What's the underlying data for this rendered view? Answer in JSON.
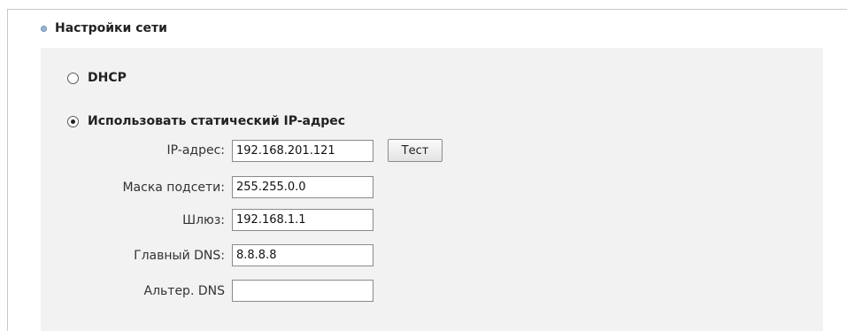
{
  "section": {
    "title": "Настройки сети"
  },
  "dhcp": {
    "label": "DHCP",
    "selected": false
  },
  "static_ip": {
    "label": "Использовать статический IP-адрес",
    "selected": true,
    "fields": {
      "ip": {
        "label": "IP-адрес:",
        "value": "192.168.201.121"
      },
      "mask": {
        "label": "Маска подсети:",
        "value": "255.255.0.0"
      },
      "gateway": {
        "label": "Шлюз:",
        "value": "192.168.1.1"
      },
      "dns_primary": {
        "label": "Главный DNS:",
        "value": "8.8.8.8"
      },
      "dns_alt": {
        "label": "Альтер. DNS",
        "value": ""
      }
    },
    "test_button_label": "Тест"
  }
}
